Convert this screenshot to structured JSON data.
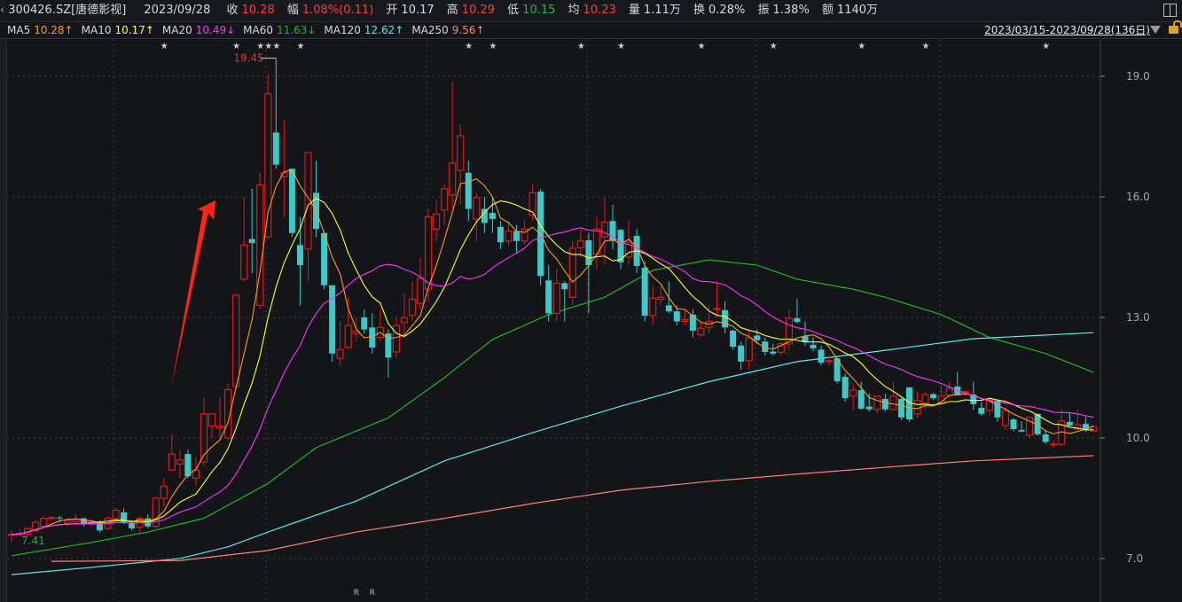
{
  "header": {
    "symbol": "300426.SZ[唐德影视]",
    "date": "2023/09/28",
    "close_label": "收",
    "close": "10.28",
    "change_label": "幅",
    "change": "1.08%(0.11)",
    "open_label": "开",
    "open": "10.17",
    "high_label": "高",
    "high": "10.29",
    "low_label": "低",
    "low": "10.15",
    "avg_label": "均",
    "avg": "10.23",
    "volume_label": "量",
    "volume": "1.11万",
    "turnover_label": "换",
    "turnover": "0.28%",
    "amplitude_label": "振",
    "amplitude": "1.38%",
    "amount_label": "额",
    "amount": "1140万"
  },
  "ma_bar": {
    "items": [
      {
        "name": "MA5",
        "value": "10.28↑",
        "color": "#ff9a1a"
      },
      {
        "name": "MA10",
        "value": "10.17↑",
        "color": "#ffff33"
      },
      {
        "name": "MA20",
        "value": "10.49↓",
        "color": "#ff33ff"
      },
      {
        "name": "MA60",
        "value": "11.63↓",
        "color": "#1fb81f"
      },
      {
        "name": "MA120",
        "value": "12.62↑",
        "color": "#55eeee"
      },
      {
        "name": "MA250",
        "value": "9.56↑",
        "color": "#ff8080"
      }
    ],
    "range": "2023/03/15-2023/09/28(136日)"
  },
  "chart_data": {
    "type": "candlestick",
    "ylim": [
      6.0,
      20.2
    ],
    "y_ticks": [
      "19.0",
      "16.0",
      "13.0",
      "10.0",
      "7.0"
    ],
    "grid": true,
    "colors": {
      "up": "#e01818",
      "down": "#3cc9c9"
    },
    "max_label": "19.45",
    "min_label": "7.41",
    "candles_ohlc": [
      [
        7.6,
        7.7,
        7.41,
        7.6
      ],
      [
        7.62,
        7.72,
        7.55,
        7.62
      ],
      [
        7.6,
        7.7,
        7.55,
        7.75
      ],
      [
        7.7,
        7.95,
        7.65,
        7.9
      ],
      [
        7.8,
        8.05,
        7.75,
        8.0
      ],
      [
        8.0,
        8.05,
        7.95,
        8.02
      ],
      [
        8.02,
        8.06,
        7.9,
        8.0
      ],
      [
        7.88,
        8.0,
        7.82,
        7.95
      ],
      [
        7.92,
        8.1,
        7.88,
        7.97
      ],
      [
        8.0,
        8.02,
        7.8,
        7.85
      ],
      [
        7.85,
        7.95,
        7.8,
        7.92
      ],
      [
        7.92,
        7.95,
        7.65,
        7.7
      ],
      [
        7.75,
        8.05,
        7.7,
        8.0
      ],
      [
        8.0,
        8.25,
        7.95,
        8.2
      ],
      [
        8.15,
        8.25,
        7.85,
        7.9
      ],
      [
        7.88,
        7.95,
        7.7,
        7.75
      ],
      [
        7.78,
        8.05,
        7.6,
        8.0
      ],
      [
        8.0,
        8.1,
        7.75,
        7.8
      ],
      [
        7.8,
        8.55,
        7.75,
        8.5
      ],
      [
        8.5,
        9.0,
        8.3,
        8.8
      ],
      [
        9.2,
        10.1,
        9.2,
        9.6
      ],
      [
        9.35,
        9.7,
        9.0,
        9.45
      ],
      [
        9.6,
        9.7,
        9.0,
        9.05
      ],
      [
        9.0,
        9.5,
        8.8,
        9.2
      ],
      [
        9.4,
        11.0,
        9.3,
        10.6
      ],
      [
        10.3,
        10.6,
        10.0,
        10.6
      ],
      [
        10.25,
        11.0,
        9.95,
        10.3
      ],
      [
        10.0,
        11.35,
        9.95,
        11.2
      ],
      [
        11.28,
        13.6,
        11.25,
        13.55
      ],
      [
        13.95,
        16.0,
        13.9,
        14.8
      ],
      [
        14.95,
        16.2,
        14.1,
        14.85
      ],
      [
        13.3,
        16.6,
        13.2,
        16.3
      ],
      [
        15.0,
        19.05,
        14.95,
        18.56
      ],
      [
        17.6,
        19.45,
        16.7,
        16.8
      ],
      [
        16.5,
        17.9,
        15.5,
        16.6
      ],
      [
        16.7,
        16.7,
        15.0,
        15.1
      ],
      [
        14.8,
        15.5,
        13.3,
        14.3
      ],
      [
        14.7,
        17.1,
        13.9,
        17.1
      ],
      [
        16.1,
        16.9,
        15.0,
        15.2
      ],
      [
        15.1,
        15.15,
        13.7,
        13.8
      ],
      [
        13.8,
        13.8,
        11.9,
        12.1
      ],
      [
        11.98,
        12.9,
        11.8,
        12.2
      ],
      [
        12.25,
        13.5,
        12.2,
        12.8
      ],
      [
        12.6,
        13.0,
        12.4,
        12.65
      ],
      [
        13.0,
        13.2,
        12.6,
        12.7
      ],
      [
        12.75,
        13.1,
        12.1,
        12.25
      ],
      [
        12.5,
        13.2,
        12.4,
        12.75
      ],
      [
        12.6,
        12.7,
        11.5,
        12.0
      ],
      [
        12.14,
        13.0,
        12.0,
        12.8
      ],
      [
        12.87,
        13.6,
        12.5,
        13.0
      ],
      [
        13.05,
        13.9,
        12.9,
        13.45
      ],
      [
        13.35,
        14.5,
        13.2,
        13.97
      ],
      [
        13.7,
        15.7,
        13.4,
        15.5
      ],
      [
        15.2,
        15.9,
        14.9,
        15.57
      ],
      [
        15.67,
        16.3,
        15.3,
        16.2
      ],
      [
        16.05,
        18.87,
        15.7,
        16.84
      ],
      [
        16.66,
        17.8,
        15.8,
        17.52
      ],
      [
        16.6,
        16.9,
        15.4,
        15.7
      ],
      [
        15.45,
        16.1,
        14.9,
        15.98
      ],
      [
        15.7,
        16.0,
        15.1,
        15.35
      ],
      [
        15.6,
        16.0,
        15.1,
        15.45
      ],
      [
        15.25,
        15.4,
        14.7,
        14.87
      ],
      [
        14.9,
        15.4,
        14.8,
        15.15
      ],
      [
        15.15,
        15.3,
        14.6,
        14.9
      ],
      [
        14.9,
        15.4,
        14.8,
        15.2
      ],
      [
        15.54,
        16.3,
        15.4,
        16.1
      ],
      [
        16.13,
        16.2,
        13.8,
        14.03
      ],
      [
        13.92,
        14.3,
        12.9,
        13.1
      ],
      [
        13.1,
        14.2,
        12.9,
        13.85
      ],
      [
        13.85,
        13.9,
        12.9,
        13.7
      ],
      [
        13.5,
        14.9,
        13.3,
        14.72
      ],
      [
        14.73,
        15.2,
        14.5,
        14.9
      ],
      [
        14.92,
        15.1,
        13.1,
        14.3
      ],
      [
        14.57,
        15.5,
        14.2,
        15.2
      ],
      [
        15.0,
        16.0,
        14.3,
        15.37
      ],
      [
        15.4,
        15.8,
        14.7,
        14.9
      ],
      [
        15.18,
        15.2,
        14.2,
        14.37
      ],
      [
        14.5,
        15.4,
        14.3,
        14.87
      ],
      [
        15.03,
        15.2,
        14.1,
        14.28
      ],
      [
        14.24,
        14.4,
        12.9,
        13.04
      ],
      [
        13.04,
        13.8,
        12.8,
        13.48
      ],
      [
        13.45,
        13.8,
        13.3,
        13.5
      ],
      [
        13.3,
        13.9,
        13.1,
        13.15
      ],
      [
        13.15,
        13.3,
        12.8,
        12.9
      ],
      [
        12.9,
        13.2,
        12.8,
        12.95
      ],
      [
        13.07,
        13.2,
        12.5,
        12.67
      ],
      [
        12.57,
        12.9,
        12.5,
        12.73
      ],
      [
        12.75,
        13.3,
        12.6,
        12.9
      ],
      [
        13.2,
        13.9,
        13.0,
        13.22
      ],
      [
        13.18,
        13.4,
        12.6,
        12.75
      ],
      [
        12.67,
        12.7,
        12.2,
        12.27
      ],
      [
        12.3,
        12.4,
        11.7,
        11.9
      ],
      [
        11.92,
        12.7,
        11.7,
        12.49
      ],
      [
        12.55,
        12.7,
        12.35,
        12.43
      ],
      [
        12.4,
        12.5,
        12.05,
        12.14
      ],
      [
        12.15,
        12.35,
        12.05,
        12.1
      ],
      [
        12.13,
        12.4,
        12.05,
        12.34
      ],
      [
        12.34,
        13.2,
        12.2,
        12.98
      ],
      [
        12.98,
        13.46,
        12.85,
        12.89
      ],
      [
        12.53,
        12.9,
        12.3,
        12.38
      ],
      [
        12.32,
        12.5,
        12.15,
        12.23
      ],
      [
        12.2,
        12.3,
        11.8,
        11.87
      ],
      [
        11.9,
        12.05,
        11.8,
        11.92
      ],
      [
        11.98,
        12.0,
        11.35,
        11.41
      ],
      [
        11.52,
        11.6,
        10.9,
        10.99
      ],
      [
        11.04,
        11.35,
        10.7,
        11.19
      ],
      [
        11.19,
        11.4,
        10.7,
        10.73
      ],
      [
        10.78,
        11.1,
        10.65,
        10.71
      ],
      [
        10.71,
        11.05,
        10.6,
        11.04
      ],
      [
        10.97,
        11.1,
        10.65,
        10.71
      ],
      [
        10.71,
        11.4,
        10.7,
        11.04
      ],
      [
        10.97,
        11.0,
        10.45,
        10.51
      ],
      [
        11.26,
        11.26,
        10.4,
        10.46
      ],
      [
        10.6,
        11.15,
        10.5,
        10.93
      ],
      [
        10.86,
        11.15,
        10.72,
        11.08
      ],
      [
        11.09,
        11.12,
        10.95,
        10.99
      ],
      [
        10.86,
        11.3,
        10.82,
        11.04
      ],
      [
        11.06,
        11.4,
        11.0,
        11.24
      ],
      [
        11.28,
        11.65,
        11.05,
        11.06
      ],
      [
        11.15,
        11.2,
        11.05,
        11.15
      ],
      [
        11.08,
        11.4,
        10.7,
        10.84
      ],
      [
        10.75,
        10.9,
        10.55,
        10.6
      ],
      [
        10.68,
        11.0,
        10.55,
        10.95
      ],
      [
        10.93,
        10.95,
        10.4,
        10.51
      ],
      [
        10.31,
        10.75,
        10.2,
        10.68
      ],
      [
        10.46,
        10.5,
        10.17,
        10.22
      ],
      [
        10.2,
        10.42,
        10.14,
        10.16
      ],
      [
        10.07,
        10.51,
        10.0,
        10.51
      ],
      [
        10.6,
        10.6,
        10.05,
        10.09
      ],
      [
        10.09,
        10.2,
        9.85,
        9.9
      ],
      [
        9.85,
        9.95,
        9.75,
        9.85
      ],
      [
        9.84,
        10.7,
        9.8,
        10.42
      ],
      [
        10.4,
        10.62,
        10.25,
        10.3
      ],
      [
        10.22,
        10.7,
        10.2,
        10.33
      ],
      [
        10.35,
        10.52,
        10.15,
        10.2
      ],
      [
        10.17,
        10.29,
        10.15,
        10.28
      ]
    ],
    "ma_computed": [
      {
        "name": "MA5",
        "period": 5,
        "color": "#ff9a1a"
      },
      {
        "name": "MA10",
        "period": 10,
        "color": "#ffff33"
      },
      {
        "name": "MA20",
        "period": 20,
        "color": "#ff33ff"
      }
    ],
    "ma_sampled": [
      {
        "name": "MA60",
        "color": "#1fb81f",
        "points": [
          [
            0,
            7.07
          ],
          [
            10,
            7.4
          ],
          [
            17,
            7.66
          ],
          [
            24,
            8.0
          ],
          [
            32,
            8.87
          ],
          [
            38,
            9.76
          ],
          [
            47,
            10.5
          ],
          [
            54,
            11.5
          ],
          [
            60,
            12.45
          ],
          [
            67,
            13.07
          ],
          [
            74,
            13.5
          ],
          [
            80,
            14.17
          ],
          [
            87,
            14.43
          ],
          [
            93,
            14.3
          ],
          [
            98,
            13.95
          ],
          [
            105,
            13.7
          ],
          [
            109,
            13.5
          ],
          [
            116,
            13.07
          ],
          [
            122,
            12.5
          ],
          [
            129,
            12.1
          ],
          [
            135,
            11.63
          ]
        ]
      },
      {
        "name": "MA120",
        "color": "#55eeee",
        "points": [
          [
            0,
            6.6
          ],
          [
            10,
            6.78
          ],
          [
            21,
            7.0
          ],
          [
            27,
            7.29
          ],
          [
            32,
            7.66
          ],
          [
            43,
            8.43
          ],
          [
            54,
            9.43
          ],
          [
            65,
            10.13
          ],
          [
            76,
            10.79
          ],
          [
            87,
            11.4
          ],
          [
            98,
            11.9
          ],
          [
            109,
            12.18
          ],
          [
            120,
            12.47
          ],
          [
            135,
            12.62
          ]
        ]
      },
      {
        "name": "MA250",
        "color": "#ff8080",
        "points": [
          [
            5,
            6.93
          ],
          [
            21,
            6.95
          ],
          [
            32,
            7.2
          ],
          [
            43,
            7.66
          ],
          [
            54,
            8.0
          ],
          [
            65,
            8.37
          ],
          [
            76,
            8.7
          ],
          [
            87,
            8.92
          ],
          [
            98,
            9.1
          ],
          [
            109,
            9.27
          ],
          [
            120,
            9.43
          ],
          [
            135,
            9.56
          ]
        ]
      }
    ],
    "event_markers": [
      19,
      28,
      31,
      32,
      33,
      36,
      57,
      60,
      71,
      76,
      86,
      95,
      106,
      114,
      129
    ],
    "r_markers": {
      "label": "R",
      "indices": [
        43,
        45
      ]
    }
  }
}
